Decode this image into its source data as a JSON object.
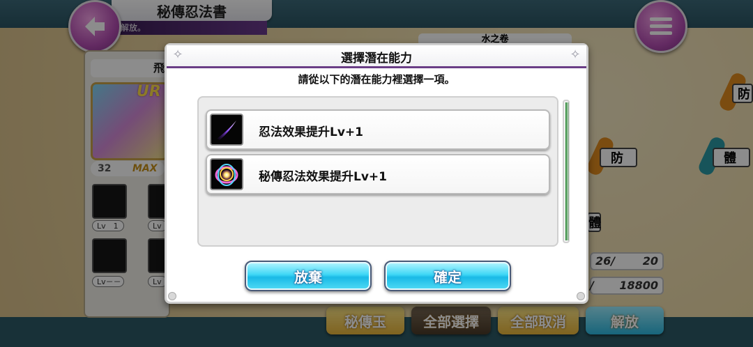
{
  "screen": {
    "title": "秘傳忍法書",
    "subtitle": "解放。",
    "back_icon": "arrow-left",
    "menu_icon": "hamburger"
  },
  "left_panel": {
    "plate_text": "飛",
    "card_rank": "UR",
    "level": "32",
    "level_max": "MAX",
    "skills": [
      {
        "level": "Lv　1"
      },
      {
        "level": "Lv"
      },
      {
        "level": "Lv－－"
      },
      {
        "level": "Lv"
      }
    ]
  },
  "background": {
    "scroll_tab": "水之卷",
    "map_nodes": [
      "防",
      "防",
      "體",
      "體"
    ],
    "stats": [
      {
        "current": "26/",
        "total": "20"
      },
      {
        "current": "/",
        "total": "18800"
      }
    ],
    "bottom_buttons": [
      "秘傳玉",
      "全部選擇",
      "全部取消",
      "解放"
    ]
  },
  "dialog": {
    "title": "選擇潛在能力",
    "instruction": "請從以下的潛在能力裡選擇一項。",
    "options": [
      {
        "label": "忍法效果提升Lv+1",
        "icon": "purple-slash-icon"
      },
      {
        "label": "秘傳忍法效果提升Lv+1",
        "icon": "rainbow-orb-icon"
      }
    ],
    "cancel_label": "放棄",
    "confirm_label": "確定"
  },
  "colors": {
    "accent_purple": "#6a3d86",
    "button_cyan": "#19b9e6",
    "scroll_green": "#2f8a3a"
  }
}
